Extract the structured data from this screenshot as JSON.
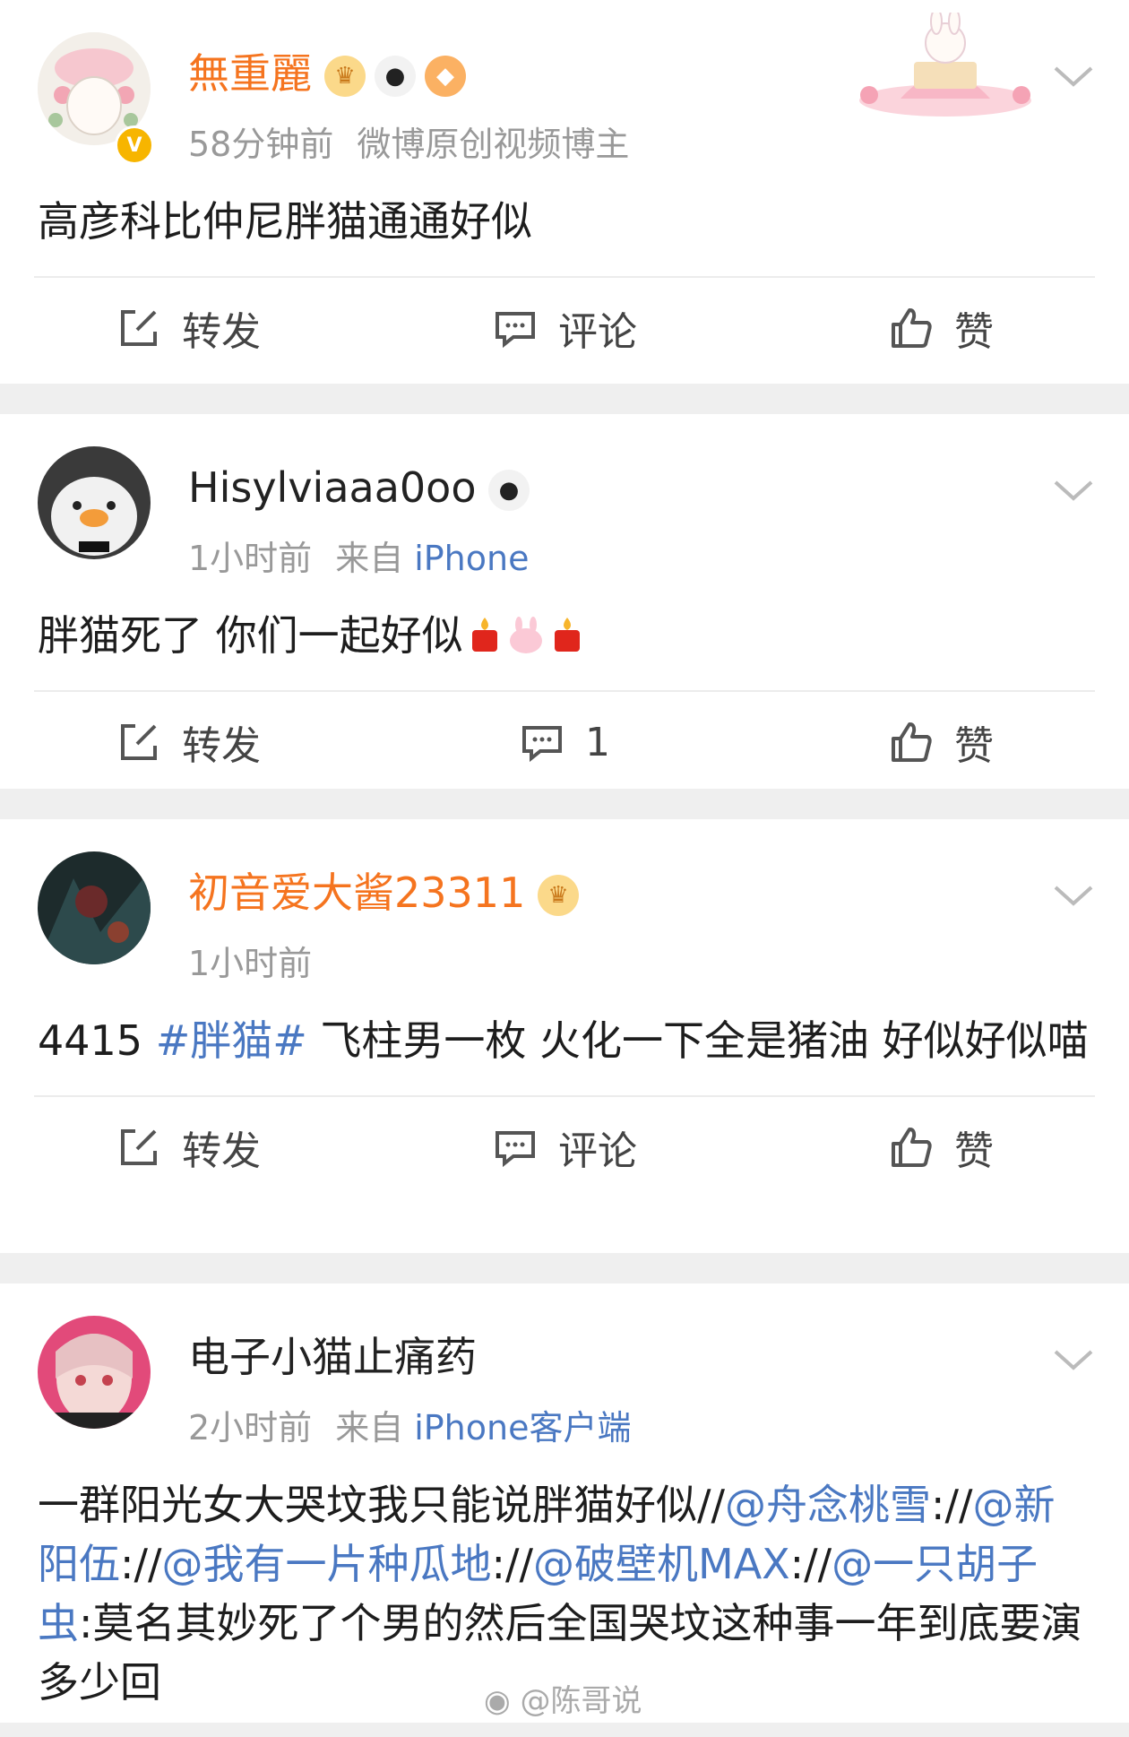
{
  "posts": [
    {
      "user": "無重麗",
      "time": "58分钟前",
      "source": "微博原创视频博主",
      "verified_mark": "V",
      "text": "高彦科比仲尼胖猫通通好似",
      "actions": {
        "repost": "转发",
        "comment": "评论",
        "like": "赞"
      }
    },
    {
      "user": "Hisylviaaa0oo",
      "time": "1小时前",
      "source_prefix": "来自",
      "source": "iPhone",
      "text": "胖猫死了 你们一起好似",
      "actions": {
        "repost": "转发",
        "comment": "1",
        "like": "赞"
      }
    },
    {
      "user": "初音爱大酱23311",
      "time": "1小时前",
      "text_prefix": "4415 ",
      "hashtag": "#胖猫#",
      "text_rest": " 飞柱男一枚  火化一下全是猪油 好似好似喵",
      "actions": {
        "repost": "转发",
        "comment": "评论",
        "like": "赞"
      }
    },
    {
      "user": "电子小猫止痛药",
      "time": "2小时前",
      "source_prefix": "来自",
      "source": "iPhone客户端",
      "text_parts": [
        {
          "t": "一群阳光女大哭坟我只能说胖猫好似//",
          "link": false
        },
        {
          "t": "@舟念桃雪",
          "link": true
        },
        {
          "t": "://",
          "link": false
        },
        {
          "t": "@新阳伍",
          "link": true
        },
        {
          "t": "://",
          "link": false
        },
        {
          "t": "@我有一片种瓜地",
          "link": true
        },
        {
          "t": "://",
          "link": false
        },
        {
          "t": "@破壁机MAX",
          "link": true
        },
        {
          "t": "://",
          "link": false
        },
        {
          "t": "@一只胡子虫",
          "link": true
        },
        {
          "t": ":莫名其妙死了个男的然后全国哭坟这种事一年到底要演多少回",
          "link": false
        }
      ]
    }
  ],
  "watermark": "@陈哥说",
  "colors": {
    "vip_name": "#f5741f",
    "link": "#4a78c2",
    "meta": "#999999",
    "separator": "#efefef"
  }
}
